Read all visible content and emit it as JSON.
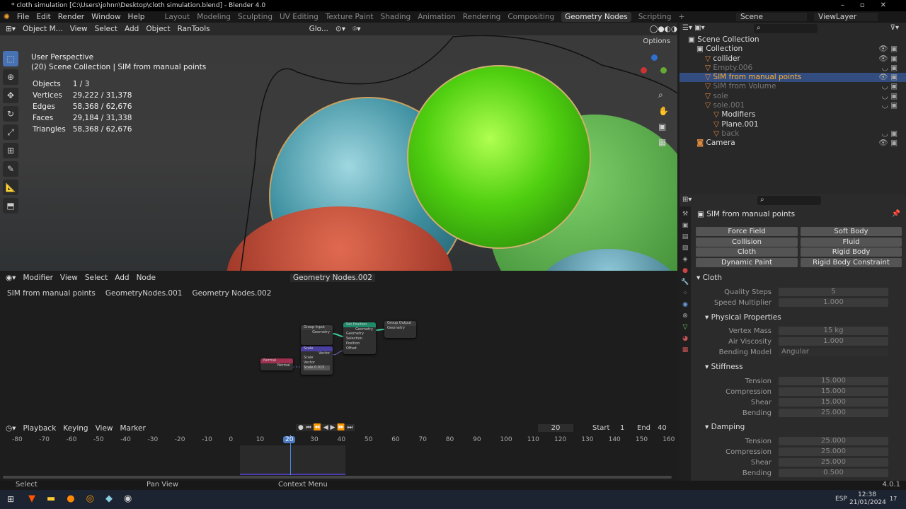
{
  "window": {
    "title": "* cloth simulation [C:\\Users\\johnn\\Desktop\\cloth simulation.blend] - Blender 4.0"
  },
  "menu": [
    "File",
    "Edit",
    "Render",
    "Window",
    "Help"
  ],
  "workspaces": [
    "Layout",
    "Modeling",
    "Sculpting",
    "UV Editing",
    "Texture Paint",
    "Shading",
    "Animation",
    "Rendering",
    "Compositing",
    "Geometry Nodes",
    "Scripting",
    "+"
  ],
  "active_workspace": "Geometry Nodes",
  "scene": "Scene",
  "view_layer": "ViewLayer",
  "viewport": {
    "mode": "Object M...",
    "menus": [
      "View",
      "Select",
      "Add",
      "Object",
      "RanTools"
    ],
    "orientation": "Glo...",
    "options": "Options",
    "perspective": "User Perspective",
    "context": "(20) Scene Collection | SIM from manual points",
    "stats": [
      [
        "Objects",
        "1 / 3"
      ],
      [
        "Vertices",
        "29,222 / 31,378"
      ],
      [
        "Edges",
        "58,368 / 62,676"
      ],
      [
        "Faces",
        "29,184 / 31,338"
      ],
      [
        "Triangles",
        "58,368 / 62,676"
      ]
    ]
  },
  "node_editor": {
    "type": "Modifier",
    "menus": [
      "View",
      "Select",
      "Add",
      "Node"
    ],
    "tree": "Geometry Nodes.002",
    "breadcrumbs": [
      "SIM from manual points",
      "GeometryNodes.001",
      "Geometry Nodes.002"
    ],
    "nodes": {
      "group_input": {
        "title": "Group Input",
        "out": "Geometry"
      },
      "set_position": {
        "title": "Set Position",
        "out": "Geometry",
        "inputs": [
          "Geometry",
          "Selection",
          "Position",
          "Offset"
        ]
      },
      "group_output": {
        "title": "Group Output",
        "in": "Geometry"
      },
      "scale": {
        "title": "Scale",
        "out": "Vector",
        "mode": "Scale",
        "in": "Vector",
        "value": "Scale  0.015"
      },
      "normal": {
        "title": "Normal",
        "out": "Normal"
      }
    }
  },
  "timeline": {
    "menus": [
      "Playback",
      "Keying",
      "View",
      "Marker"
    ],
    "current": "20",
    "start_label": "Start",
    "start": "1",
    "end_label": "End",
    "end": "40",
    "ticks": [
      "-80",
      "-70",
      "-60",
      "-50",
      "-40",
      "-30",
      "-20",
      "-10",
      "0",
      "10",
      "20",
      "30",
      "40",
      "50",
      "60",
      "70",
      "80",
      "90",
      "100",
      "110",
      "120",
      "130",
      "140",
      "150",
      "160"
    ]
  },
  "status": {
    "select": "Select",
    "pan": "Pan View",
    "context": "Context Menu",
    "version": "4.0.1"
  },
  "outliner": {
    "items": [
      {
        "label": "Scene Collection",
        "indent": 0,
        "dim": false
      },
      {
        "label": "Collection",
        "indent": 1,
        "dim": false
      },
      {
        "label": "collider",
        "indent": 2,
        "dim": false
      },
      {
        "label": "Empty.006",
        "indent": 2,
        "dim": true
      },
      {
        "label": "SIM from manual points",
        "indent": 2,
        "dim": false,
        "selected": true
      },
      {
        "label": "SIM from Volume",
        "indent": 2,
        "dim": true
      },
      {
        "label": "sole",
        "indent": 2,
        "dim": true
      },
      {
        "label": "sole.001",
        "indent": 2,
        "dim": true
      },
      {
        "label": "Modifiers",
        "indent": 3,
        "dim": false
      },
      {
        "label": "Plane.001",
        "indent": 3,
        "dim": false
      },
      {
        "label": "back",
        "indent": 3,
        "dim": true
      },
      {
        "label": "Camera",
        "indent": 1,
        "dim": false
      }
    ]
  },
  "properties": {
    "object": "SIM from manual points",
    "physics_buttons": [
      "Force Field",
      "Soft Body",
      "Collision",
      "Fluid",
      "Cloth",
      "Rigid Body",
      "Dynamic Paint",
      "Rigid Body Constraint"
    ],
    "cloth": {
      "title": "Cloth",
      "quality_label": "Quality Steps",
      "quality": "5",
      "speed_label": "Speed Multiplier",
      "speed": "1.000"
    },
    "physical": {
      "title": "Physical Properties",
      "mass_label": "Vertex Mass",
      "mass": "15 kg",
      "air_label": "Air Viscosity",
      "air": "1.000",
      "bend_model_label": "Bending Model",
      "bend_model": "Angular"
    },
    "stiffness": {
      "title": "Stiffness",
      "rows": [
        [
          "Tension",
          "15.000"
        ],
        [
          "Compression",
          "15.000"
        ],
        [
          "Shear",
          "15.000"
        ],
        [
          "Bending",
          "25.000"
        ]
      ]
    },
    "damping": {
      "title": "Damping",
      "rows": [
        [
          "Tension",
          "25.000"
        ],
        [
          "Compression",
          "25.000"
        ],
        [
          "Shear",
          "25.000"
        ],
        [
          "Bending",
          "0.500"
        ]
      ]
    }
  },
  "taskbar": {
    "lang": "ESP",
    "time": "12:38",
    "date": "21/01/2024",
    "notifications": "17"
  }
}
